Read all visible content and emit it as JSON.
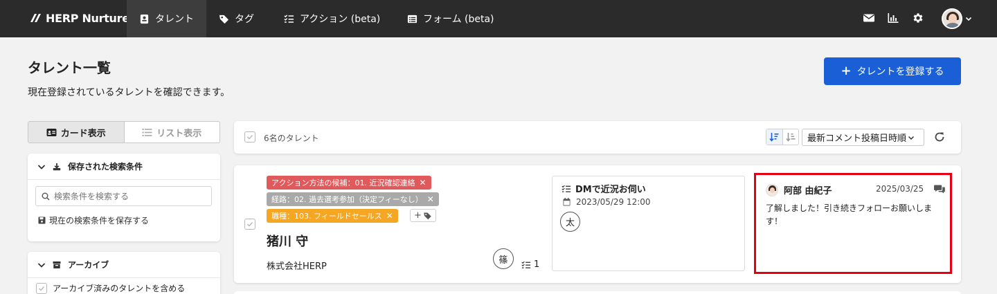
{
  "nav": {
    "brand": "HERP Nurture",
    "items": [
      {
        "label": "タレント",
        "icon": "person-badge-icon",
        "active": true
      },
      {
        "label": "タグ",
        "icon": "tag-icon",
        "active": false
      },
      {
        "label": "アクション (beta)",
        "icon": "checklist-icon",
        "active": false
      },
      {
        "label": "フォーム (beta)",
        "icon": "form-icon",
        "active": false
      }
    ],
    "right_icons": [
      "mail-icon",
      "chart-icon",
      "gear-icon",
      "avatar",
      "chevron-down-icon"
    ]
  },
  "header": {
    "title": "タレント一覧",
    "description": "現在登録されているタレントを確認できます。",
    "register_button": "タレントを登録する"
  },
  "view_toggle": {
    "card_label": "カード表示",
    "list_label": "リスト表示",
    "selected": "card"
  },
  "saved_search": {
    "title": "保存された検索条件",
    "search_placeholder": "検索条件を検索する",
    "save_link": "現在の検索条件を保存する"
  },
  "archive": {
    "title": "アーカイブ",
    "include_label": "アーカイブ済みのタレントを含める",
    "include_checked": false
  },
  "list_toolbar": {
    "count_text": "6名のタレント",
    "sort_label": "最新コメント投稿日時順"
  },
  "talent": {
    "tags": [
      {
        "label": "アクション方法の候補：01. 近況確認連絡",
        "color": "#e0595b"
      },
      {
        "label": "経路：02. 過去選考参加（決定フィーなし）",
        "color": "#a9a9a9"
      },
      {
        "label": "職種：103. フィールドセールス",
        "color": "#f5a623"
      }
    ],
    "add_tag_label": "+",
    "name": "猪川 守",
    "company": "株式会社HERP",
    "owner_initial": "篠",
    "action_count": "1",
    "action": {
      "title": "DMで近況お伺い",
      "datetime": "2023/05/29 12:00",
      "assignee_initial": "太"
    },
    "latest_comment": {
      "author": "阿部 由紀子",
      "date": "2025/03/25",
      "text": "了解しました！引き続きフォローお願いします！"
    }
  },
  "colors": {
    "nav_bg": "#2b2b2b",
    "primary": "#1a5fd6",
    "highlight": "#e60012"
  }
}
